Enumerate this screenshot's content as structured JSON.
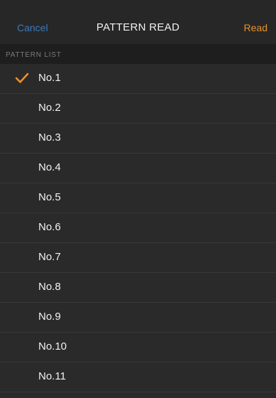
{
  "navbar": {
    "cancel_label": "Cancel",
    "title": "PATTERN READ",
    "read_label": "Read"
  },
  "section": {
    "header": "PATTERN LIST"
  },
  "patterns": [
    {
      "label": "No.1",
      "selected": true
    },
    {
      "label": "No.2",
      "selected": false
    },
    {
      "label": "No.3",
      "selected": false
    },
    {
      "label": "No.4",
      "selected": false
    },
    {
      "label": "No.5",
      "selected": false
    },
    {
      "label": "No.6",
      "selected": false
    },
    {
      "label": "No.7",
      "selected": false
    },
    {
      "label": "No.8",
      "selected": false
    },
    {
      "label": "No.9",
      "selected": false
    },
    {
      "label": "No.10",
      "selected": false
    },
    {
      "label": "No.11",
      "selected": false
    }
  ],
  "colors": {
    "accent_orange": "#e8922b",
    "cancel_blue": "#3d7ab8",
    "background": "#2a2a2a"
  },
  "icons": {
    "selected": "checkmark-icon"
  }
}
